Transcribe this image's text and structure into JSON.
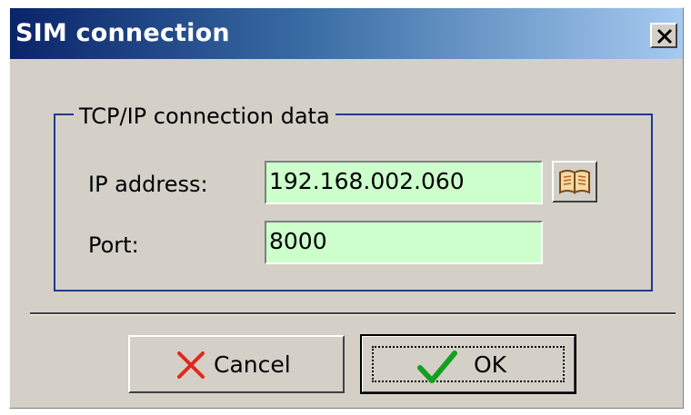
{
  "window": {
    "title": "SIM connection",
    "close_icon": "close-icon"
  },
  "group": {
    "label": "TCP/IP connection data"
  },
  "fields": {
    "ip_label": "IP address:",
    "ip_value": "192.168.002.060",
    "port_label": "Port:",
    "port_value": "8000"
  },
  "buttons": {
    "browse_icon": "address-book-icon",
    "cancel_label": "Cancel",
    "cancel_icon": "red-x-icon",
    "ok_label": "OK",
    "ok_icon": "green-check-icon"
  },
  "colors": {
    "title_gradient_start": "#0a246a",
    "title_gradient_end": "#a6caf0",
    "input_background": "#ccffcc",
    "groupbox_border": "#1f3a8a",
    "dialog_face": "#d4d0c8"
  }
}
